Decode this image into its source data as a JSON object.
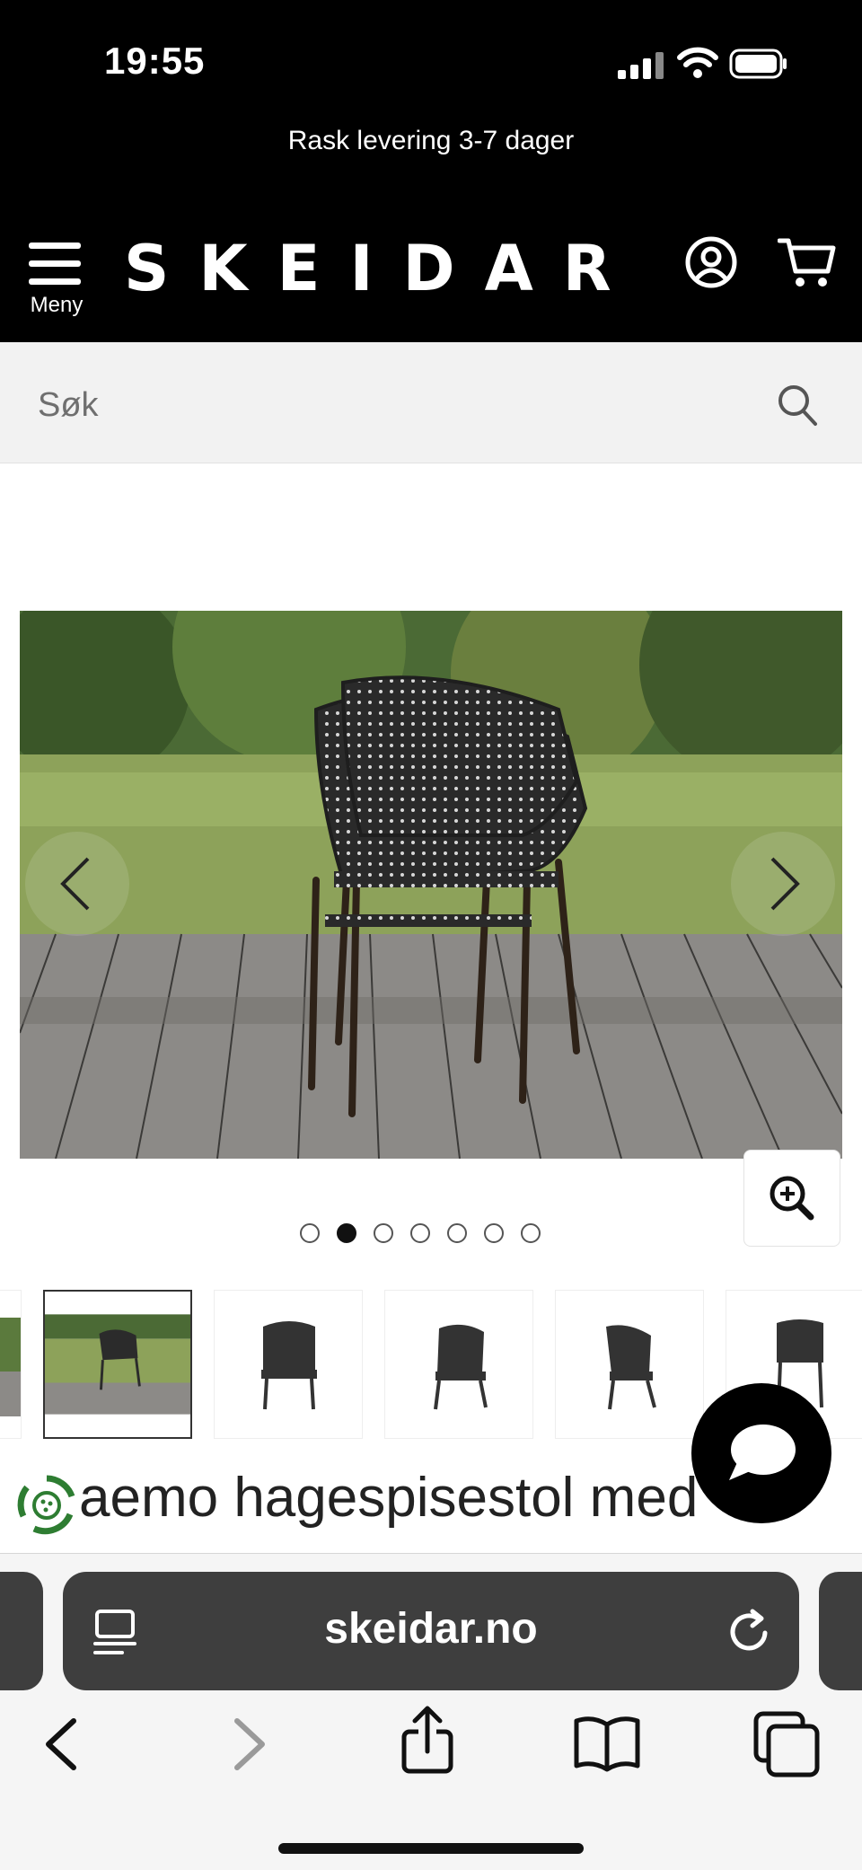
{
  "status_bar": {
    "time": "19:55"
  },
  "promo_banner": {
    "text": "Rask levering 3-7 dager"
  },
  "header": {
    "menu_label": "Meny",
    "logo_text": "SKEIDAR"
  },
  "search": {
    "placeholder": "Søk"
  },
  "gallery": {
    "dot_count": 7,
    "active_index": 1,
    "thumbnail_count": 6,
    "selected_thumbnail": 1
  },
  "product": {
    "title_visible": "aemo hagespisestol med"
  },
  "browser": {
    "url": "skeidar.no"
  },
  "colors": {
    "header_bg": "#000000",
    "search_bg": "#f2f2f2",
    "url_bar_bg": "#3e3e3e",
    "eco_green": "#2e7d32"
  }
}
